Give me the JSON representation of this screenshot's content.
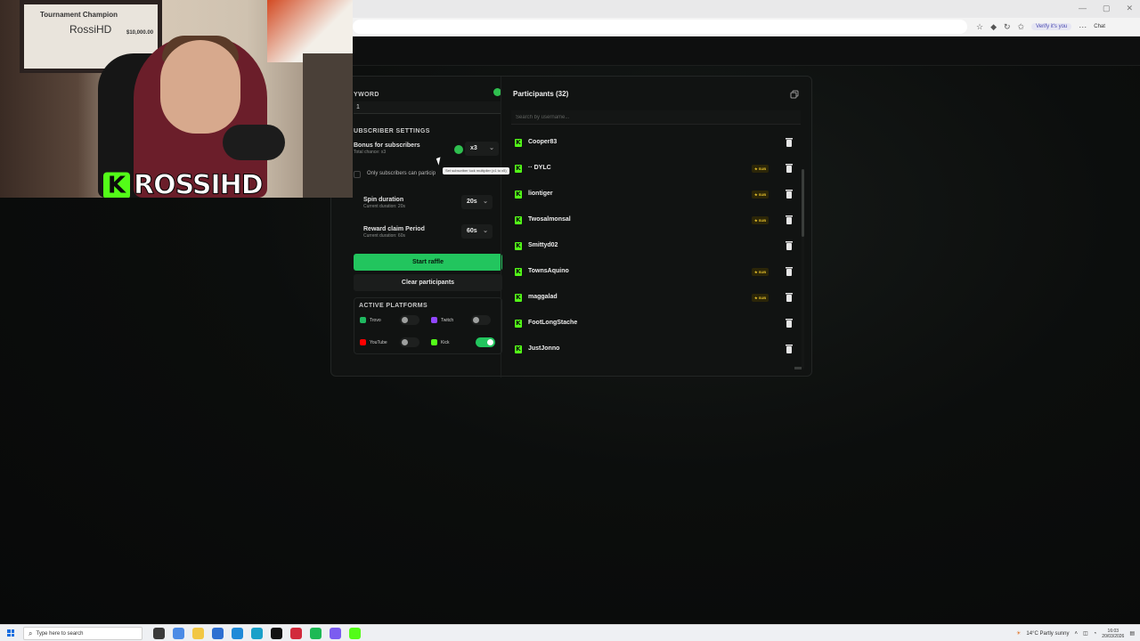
{
  "browser": {
    "verify_chip": "Verify it's you",
    "chat_label": "Chat"
  },
  "webcam": {
    "frame_title": "Tournament Champion",
    "frame_name": "RossiHD",
    "frame_amount": "$10,000.00",
    "banner_icon": "K",
    "banner_name": "ROSSIHD"
  },
  "settings": {
    "keyword_title": "YWORD",
    "keyword_value": "1",
    "subscriber_title": "UBSCRIBER SETTINGS",
    "bonus_label": "Bonus for subscribers",
    "bonus_sub": "Total chance: x3",
    "bonus_value": "x3",
    "only_subs_label": "Only subscribers can particip",
    "tooltip": "Set subscriber luck multiplier (x1 to x5)",
    "spin_label": "Spin duration",
    "spin_sub": "Current duration: 20s",
    "spin_value": "20s",
    "reward_label": "Reward claim Period",
    "reward_sub": "Current duration: 60s",
    "reward_value": "60s",
    "start_button": "Start raffle",
    "clear_button": "Clear participants",
    "platforms_title": "ACTIVE PLATFORMS",
    "platforms": [
      {
        "name": "Trovo",
        "enabled": false,
        "color": "#1fb860"
      },
      {
        "name": "Twitch",
        "enabled": false,
        "color": "#9146ff"
      },
      {
        "name": "YouTube",
        "enabled": false,
        "color": "#ff0000"
      },
      {
        "name": "Kick",
        "enabled": true,
        "color": "#53fc18"
      }
    ]
  },
  "participants": {
    "title": "Participants (32)",
    "search_placeholder": "Search by username...",
    "sub_badge": "★ SUB",
    "items": [
      {
        "name": "Cooper83",
        "sub": false
      },
      {
        "name": "·· DYLC",
        "sub": true
      },
      {
        "name": "liontiger",
        "sub": true
      },
      {
        "name": "Twosalmonsal",
        "sub": true
      },
      {
        "name": "Smittyd02",
        "sub": false
      },
      {
        "name": "TownsAquino",
        "sub": true
      },
      {
        "name": "maggalad",
        "sub": true
      },
      {
        "name": "FootLongStache",
        "sub": false
      },
      {
        "name": "JustJonno",
        "sub": false
      }
    ]
  },
  "taskbar": {
    "search_placeholder": "Type here to search",
    "weather": "14°C  Partly sunny",
    "time": "16:03",
    "date": "20/03/2026"
  },
  "colors": {
    "accent": "#22c55e",
    "kick": "#53fc18",
    "sub_badge": "#e8c22c"
  }
}
